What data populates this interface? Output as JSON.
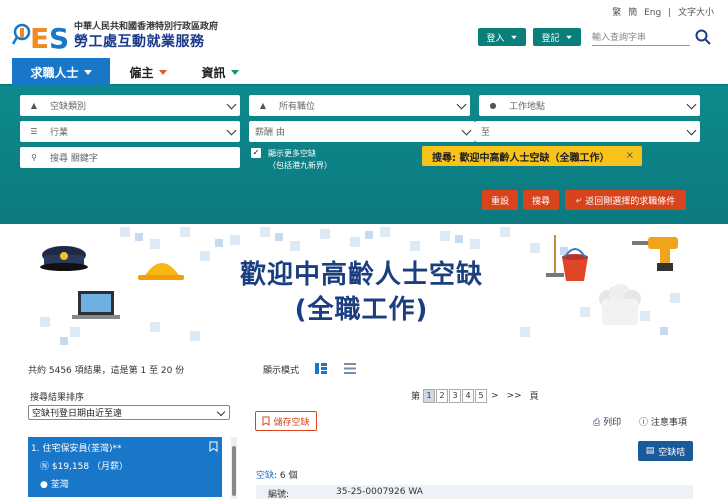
{
  "header": {
    "gov_name": "中華人民共和國香港特別行政區政府",
    "dept_name": "勞工處互動就業服務",
    "logo_letters": "iES",
    "lang_links": [
      "繁",
      "簡",
      "Eng",
      "|",
      "文字大小"
    ],
    "login_label": "登入",
    "register_label": "登記",
    "search_placeholder": "輸入查詢字串"
  },
  "nav": {
    "items": [
      {
        "label": "求職人士",
        "active": true
      },
      {
        "label": "僱主",
        "active": false
      },
      {
        "label": "資訊",
        "active": false
      }
    ]
  },
  "filters": {
    "vacancy_type": "空缺類別",
    "all_positions": "所有職位",
    "work_location": "工作地點",
    "industry": "行業",
    "salary_from": "薪酬 由",
    "salary_to": "至",
    "keyword_placeholder": "搜尋 關鍵字",
    "show_more_line1": "顯示更多空缺",
    "show_more_line2": "（包括港九新界）",
    "active_tag": "搜尋: 歡迎中高齡人士空缺（全職工作）",
    "tag_close": "×",
    "reset_label": "重設",
    "search_label": "搜尋",
    "back_label": "返回剛選擇的求職條件"
  },
  "banner": {
    "title_line1": "歡迎中高齡人士空缺",
    "title_line2": "(全職工作)"
  },
  "results": {
    "count_text": "共約 5456 項結果，這是第 1 至 20 份",
    "display_mode_label": "顯示模式"
  },
  "sort": {
    "label": "搜尋結果排序",
    "selected": "空缺刊登日期由近至遠"
  },
  "job_list": [
    {
      "title": "1. 住宅保安員(荃灣)**",
      "salary": "$19,158 （月薪）",
      "location": "荃灣"
    }
  ],
  "pager": {
    "prefix": "第",
    "pages": [
      "1",
      "2",
      "3",
      "4",
      "5"
    ],
    "next": ">",
    "last": ">>",
    "suffix": "頁"
  },
  "detail": {
    "save_label": "儲存空缺",
    "print_label": "列印",
    "notice_label": "注意事項",
    "vacancy_btn_label": "空缺咭",
    "vacancy_count_label": "空缺",
    "vacancy_count_value": "6 個",
    "row_key": "編號:",
    "row_value": "35-25-0007926 WA"
  },
  "colors": {
    "teal": "#0b7d80",
    "blue": "#1877c9",
    "red": "#d8431c",
    "yellow": "#f7c21a",
    "navy": "#1a3e7f"
  }
}
